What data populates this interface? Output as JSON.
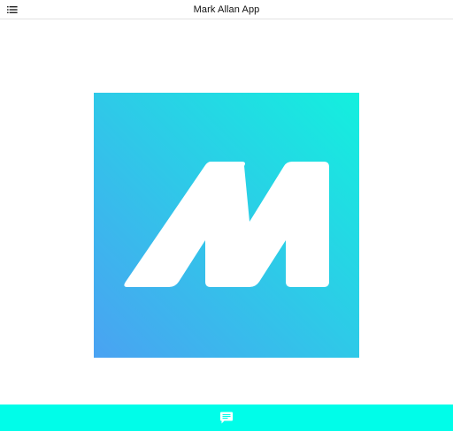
{
  "header": {
    "title": "Mark Allan App",
    "menu_icon": "list-menu-icon"
  },
  "logo": {
    "icon": "m-logo",
    "gradient_start": "#4aa2f2",
    "gradient_end": "#13f0de",
    "letter_color": "#ffffff"
  },
  "footer": {
    "background": "#00fde9",
    "chat_icon": "chat-bubble-icon",
    "icon_color": "#ffffff"
  }
}
